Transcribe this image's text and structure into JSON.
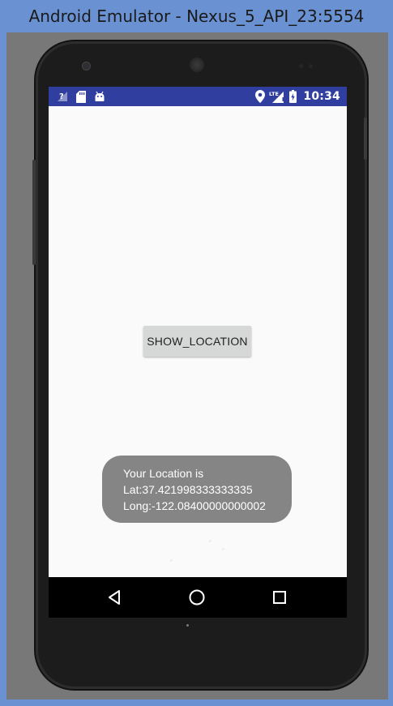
{
  "window": {
    "title": "Android Emulator - Nexus_5_API_23:5554"
  },
  "statusbar": {
    "time": "10:34",
    "left_icons": [
      "no-signal-icon",
      "sd-card-icon",
      "android-debug-icon"
    ],
    "right_icons": [
      "location-icon",
      "lte-signal-icon",
      "battery-charging-icon"
    ],
    "network_label": "LTE"
  },
  "app": {
    "show_location_label": "SHOW_LOCATION"
  },
  "toast": {
    "line1": "Your Location is",
    "line2": "Lat:37.421998333333335",
    "line3": "Long:-122.08400000000002"
  },
  "navbar": {
    "buttons": [
      "back-icon",
      "home-icon",
      "recents-icon"
    ]
  },
  "colors": {
    "window_frame": "#6a92d3",
    "status_bar": "#303f9f",
    "screen_background": "#fafafa",
    "button": "#d6d7d7",
    "toast": "#858585",
    "nav_bar": "#000000"
  }
}
